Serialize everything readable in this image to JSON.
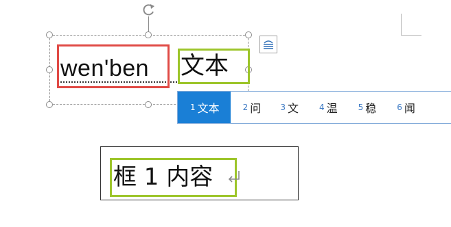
{
  "editor": {
    "pinyin_input": "wen'ben",
    "composition_preview": "文本",
    "second_box_text": "框 1 内容",
    "rotate_handle_icon": "rotate-arrow-icon",
    "layout_options_icon": "layout-options-icon",
    "paragraph_mark_icon": "paragraph-return-icon"
  },
  "ime": {
    "candidates": [
      {
        "num": "1",
        "text": "文本",
        "selected": true
      },
      {
        "num": "2",
        "text": "问",
        "selected": false
      },
      {
        "num": "3",
        "text": "文",
        "selected": false
      },
      {
        "num": "4",
        "text": "温",
        "selected": false
      },
      {
        "num": "5",
        "text": "稳",
        "selected": false
      },
      {
        "num": "6",
        "text": "闻",
        "selected": false
      }
    ],
    "selected_bg_color": "#1a7fd6"
  },
  "annotation_colors": {
    "red_highlight": "#e04a45",
    "green_highlight": "#9dc52b"
  }
}
